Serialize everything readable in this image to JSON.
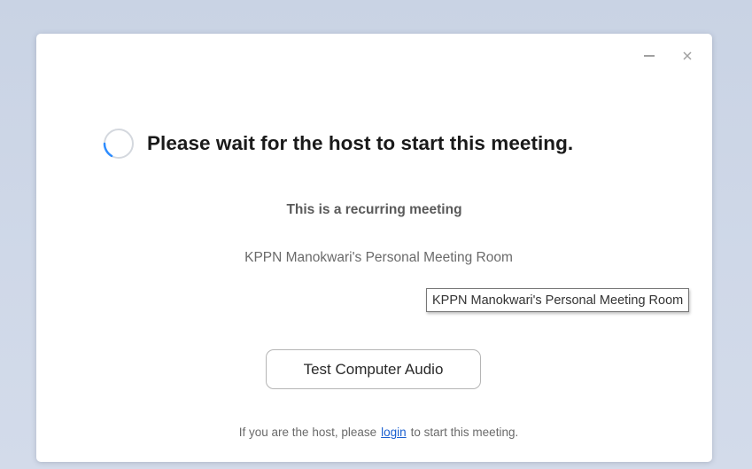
{
  "window": {
    "minimize_icon": "minimize-icon",
    "close_icon": "close-icon"
  },
  "status": {
    "headline": "Please wait for the host to start this meeting.",
    "spinner_icon": "loading-spinner-icon",
    "spinner_color": "#2d8cff"
  },
  "meeting": {
    "recurring_label": "This is a recurring meeting",
    "room_name": "KPPN Manokwari's Personal Meeting Room"
  },
  "actions": {
    "test_audio_label": "Test Computer Audio"
  },
  "footer": {
    "prefix": "If you are the host, please",
    "login_link": "login",
    "suffix": "to start this meeting."
  },
  "tooltip": {
    "text": "KPPN Manokwari's Personal Meeting Room"
  }
}
